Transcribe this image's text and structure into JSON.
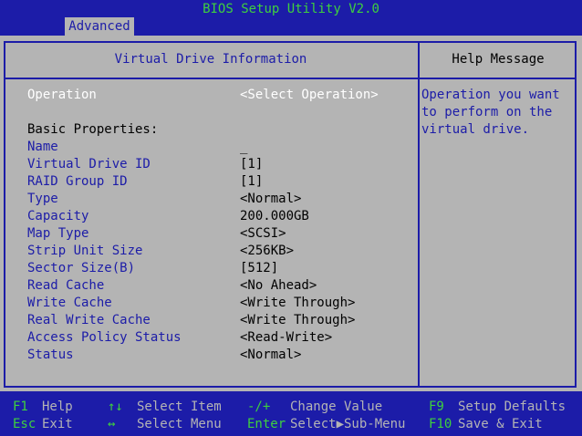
{
  "header": {
    "title": "BIOS Setup Utility V2.0",
    "tab": "Advanced"
  },
  "panel": {
    "title": "Virtual Drive Information",
    "operation": {
      "label": "Operation",
      "value": "<Select Operation>"
    },
    "section_title": "Basic Properties:",
    "properties": [
      {
        "label": "Name",
        "value": "_"
      },
      {
        "label": "Virtual Drive ID",
        "value": "[1]"
      },
      {
        "label": "RAID Group ID",
        "value": "[1]"
      },
      {
        "label": "Type",
        "value": "<Normal>"
      },
      {
        "label": "Capacity",
        "value": "200.000GB"
      },
      {
        "label": "Map Type",
        "value": "<SCSI>"
      },
      {
        "label": "Strip Unit Size",
        "value": "<256KB>"
      },
      {
        "label": "Sector Size(B)",
        "value": "[512]"
      },
      {
        "label": "Read Cache",
        "value": "<No Ahead>"
      },
      {
        "label": "Write Cache",
        "value": "<Write Through>"
      },
      {
        "label": "Real Write Cache",
        "value": "<Write Through>"
      },
      {
        "label": "Access Policy Status",
        "value": "<Read-Write>"
      },
      {
        "label": "Status",
        "value": "<Normal>"
      }
    ]
  },
  "help": {
    "title": "Help Message",
    "text": "Operation you want\nto perform on the\nvirtual drive."
  },
  "footer": {
    "f1_key": "F1",
    "f1_desc": "Help",
    "esc_key": "Esc",
    "esc_desc": "Exit",
    "updown_key": "↑↓",
    "updown_desc": "Select Item",
    "leftright_key": "↔",
    "leftright_desc": "Select Menu",
    "plusminus_key": "-/+",
    "plusminus_desc": "Change Value",
    "enter_key": "Enter",
    "enter_desc": "Select▶Sub-Menu",
    "f9_key": "F9",
    "f9_desc": "Setup Defaults",
    "f10_key": "F10",
    "f10_desc": "Save & Exit"
  },
  "colors": {
    "background": "#1c1ca8",
    "panel": "#b4b4b4",
    "accent": "#3ed03e",
    "white": "#ffffff"
  }
}
